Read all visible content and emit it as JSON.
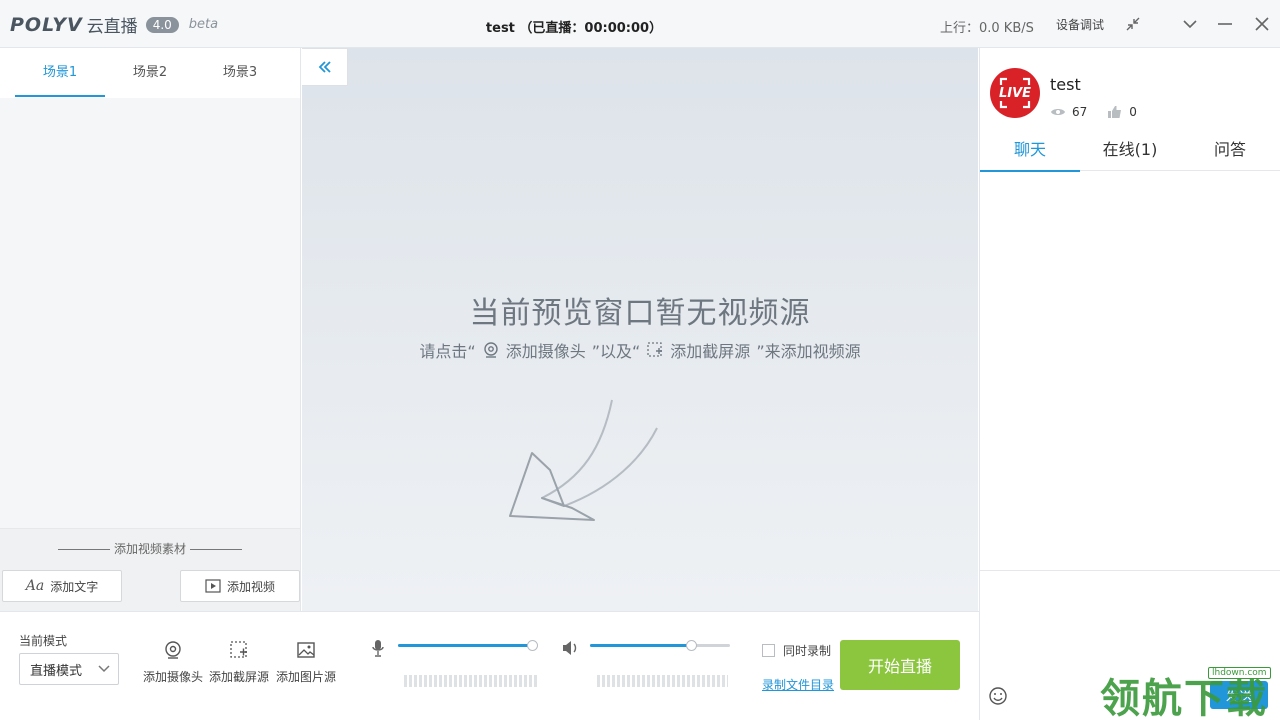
{
  "titlebar": {
    "logo_brand": "POLYV",
    "logo_cn": "云直播",
    "logo_version": "4.0",
    "logo_beta": "beta",
    "title": "test （已直播：00:00:00）",
    "upload_speed": "上行：0.0 KB/S",
    "device_test_label": "设备调试"
  },
  "scenes": {
    "tabs": [
      {
        "label": "场景1",
        "active": true
      },
      {
        "label": "场景2",
        "active": false
      },
      {
        "label": "场景3",
        "active": false
      }
    ],
    "add_material_title": "添加视频素材",
    "add_text_label": "添加文字",
    "add_video_label": "添加视频"
  },
  "preview": {
    "empty_title": "当前预览窗口暂无视频源",
    "hint_prefix": "请点击“",
    "hint_camera": "添加摄像头",
    "hint_middle": "”以及“",
    "hint_screen": "添加截屏源",
    "hint_suffix": "”来添加视频源"
  },
  "channel": {
    "name": "test",
    "views": "67",
    "likes": "0",
    "avatar_text": "LIVE"
  },
  "chat": {
    "tabs": [
      {
        "label": "聊天",
        "active": true
      },
      {
        "label": "在线(1)",
        "active": false
      },
      {
        "label": "问答",
        "active": false
      }
    ],
    "send_label": "发送"
  },
  "watermark": {
    "text": "领航下载",
    "small": "lhdown.com"
  },
  "bottom": {
    "mode_label": "当前模式",
    "mode_value": "直播模式",
    "add_camera_label": "添加摄像头",
    "add_screen_label": "添加截屏源",
    "add_image_label": "添加图片源",
    "mic_level": 0.96,
    "speaker_level": 0.72,
    "sync_record_label": "同时录制",
    "record_dir_label": "录制文件目录",
    "start_label": "开始直播"
  },
  "colors": {
    "accent": "#2196d8",
    "start_button": "#8cc63f",
    "live_red": "#d92128"
  }
}
